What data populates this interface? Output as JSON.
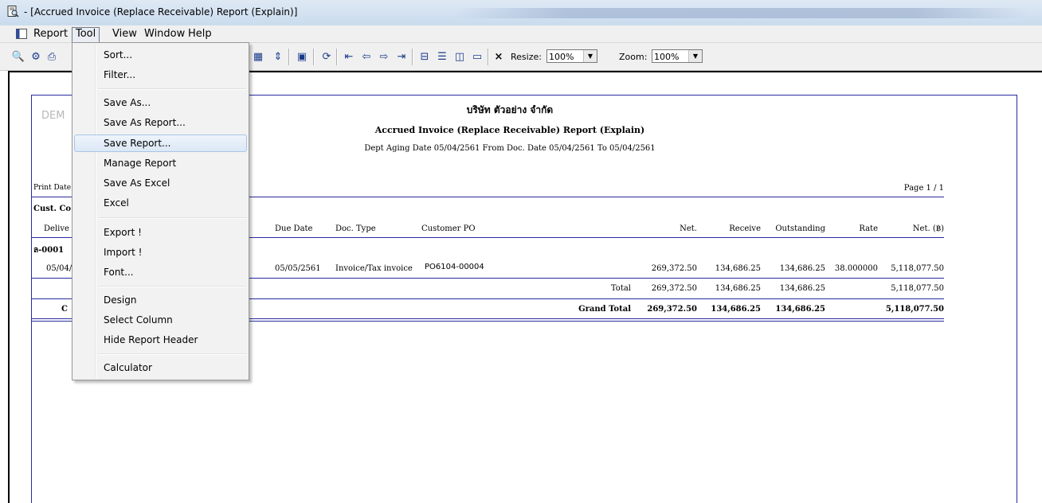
{
  "window": {
    "title": "- [Accrued Invoice (Replace Receivable) Report (Explain)]"
  },
  "menubar": {
    "items": [
      "Report",
      "Tool",
      "View",
      "Window",
      "Help"
    ],
    "active": "Tool"
  },
  "toolbar": {
    "resize_label": "Resize:",
    "resize_value": "100%",
    "zoom_label": "Zoom:",
    "zoom_value": "100%",
    "close_glyph": "×"
  },
  "tool_menu": {
    "items": [
      "Sort...",
      "Filter...",
      "Save As...",
      "Save As Report...",
      "Save Report...",
      "Manage Report",
      "Save As Excel",
      "Excel",
      "Export !",
      "Import !",
      "Font...",
      "Design",
      "Select Column",
      "Hide Report Header",
      "Calculator"
    ],
    "highlighted": "Save Report..."
  },
  "report": {
    "company": "บริษัท ตัวอย่าง จำกัด",
    "title": "Accrued Invoice (Replace Receivable) Report (Explain)",
    "subtitle": "Dept Aging Date 05/04/2561 From Doc. Date 05/04/2561 To 05/04/2561",
    "logo_partial": "DEM",
    "print_date_label": "Print Date",
    "page": "Page 1 / 1",
    "group_label_partial": "Cust. Co",
    "deliver_label_partial": "Delive",
    "columns": [
      "Due Date",
      "Doc. Type",
      "Customer PO",
      "Net.",
      "Receive",
      "Outstanding",
      "Rate",
      "Net. (฿)"
    ],
    "group_code": "ล-0001",
    "row": {
      "date_partial": "05/04/",
      "due_date": "05/05/2561",
      "doc_type": "Invoice/Tax invoice",
      "customer_po": "PO6104-00004",
      "net": "269,372.50",
      "receive": "134,686.25",
      "outstanding": "134,686.25",
      "rate": "38.000000",
      "net_baht": "5,118,077.50"
    },
    "total": {
      "label": "Total",
      "net": "269,372.50",
      "receive": "134,686.25",
      "outstanding": "134,686.25",
      "net_baht": "5,118,077.50"
    },
    "grand_total": {
      "label": "Grand Total",
      "left_partial": "C",
      "net": "269,372.50",
      "receive": "134,686.25",
      "outstanding": "134,686.25",
      "net_baht": "5,118,077.50"
    }
  }
}
